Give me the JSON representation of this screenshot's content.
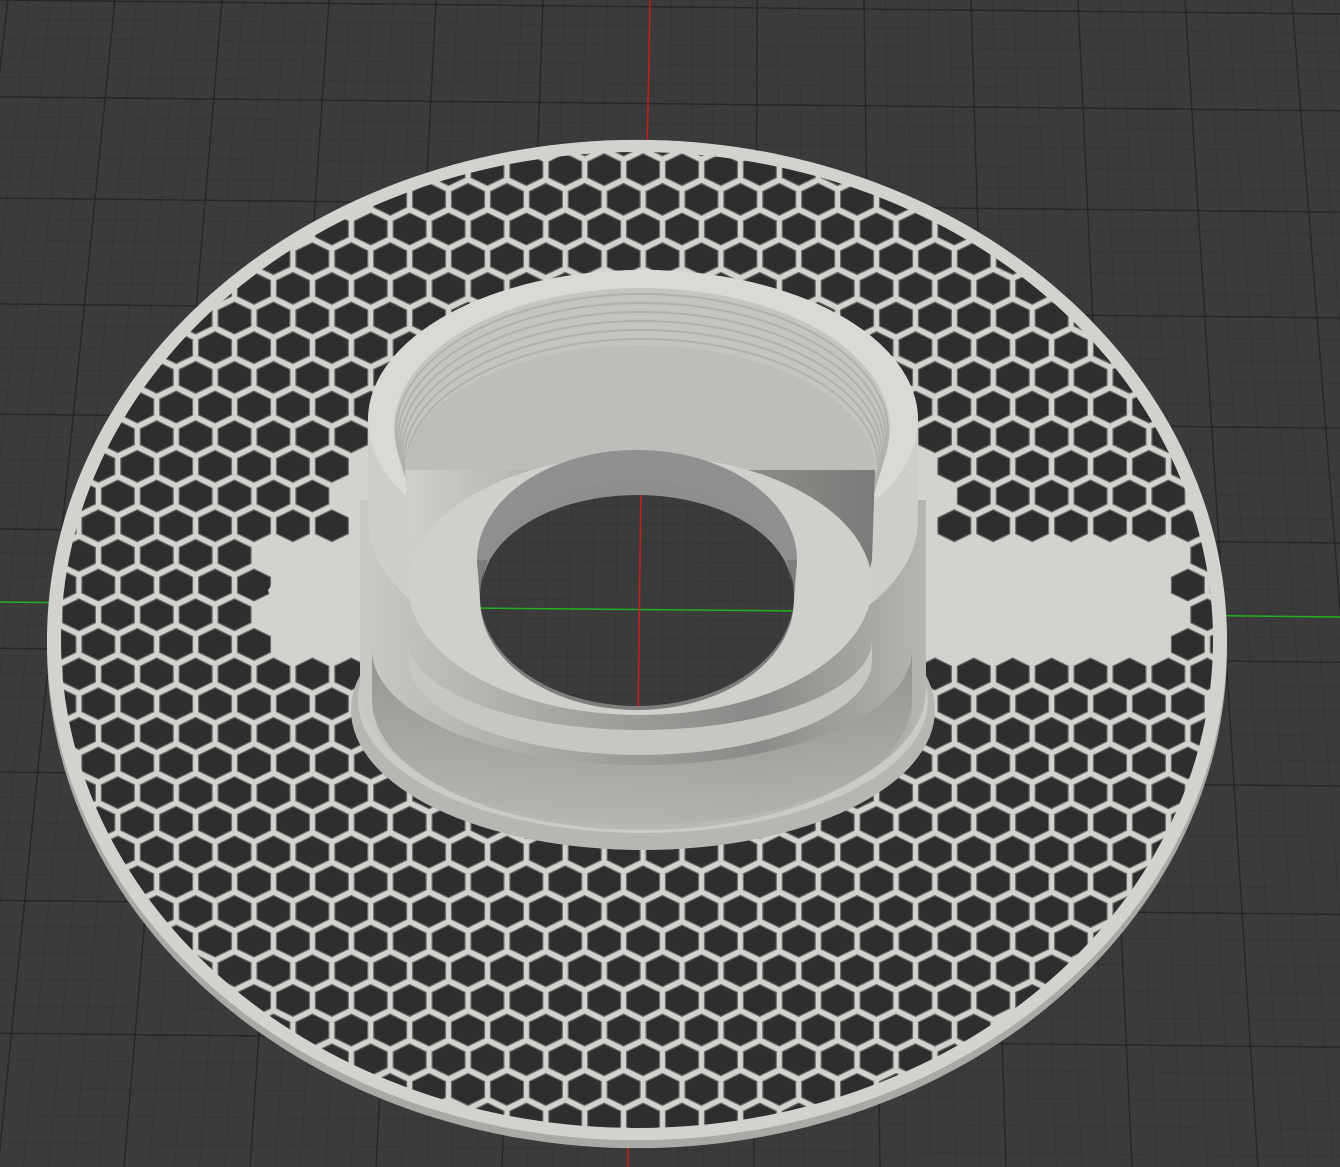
{
  "viewport": {
    "background_color": "#3b3b3b",
    "grid_minor_color": "#353535",
    "grid_major_color": "#262626",
    "axis_x_color": "#22b022",
    "axis_y_color": "#c81e1e"
  },
  "model": {
    "name_icon": "honeycomb-spool-adapter",
    "surface_color": "#d2d2cf",
    "shade_color": "#a9a9a6",
    "dark_shade_color": "#6c6c6a",
    "pattern": "hexagonal-honeycomb",
    "hub": "threaded-ring-with-center-hole",
    "spokes": 2
  }
}
